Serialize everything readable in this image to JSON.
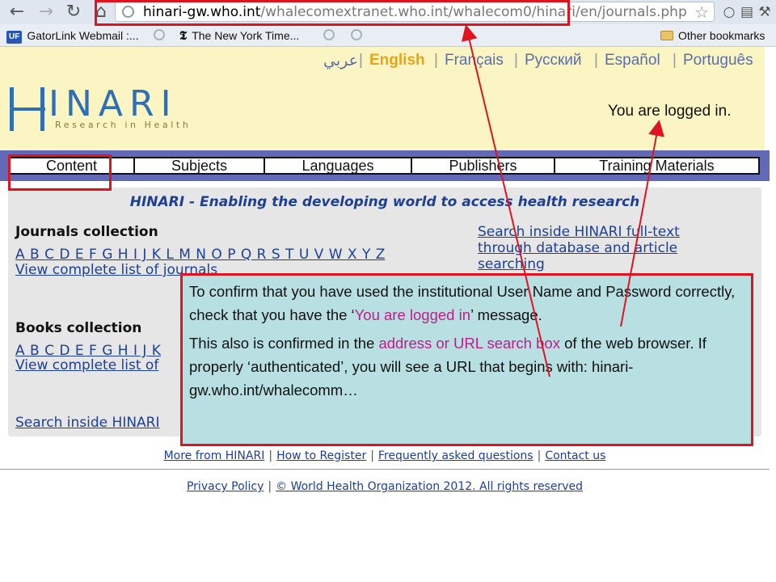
{
  "browser": {
    "url_host": "hinari-gw.who.int",
    "url_path": "/whalecomextranet.who.int/whalecom0/hinari/en/journals.php",
    "nav_icons": [
      "back-icon",
      "forward-icon",
      "reload-icon",
      "home-icon"
    ],
    "toolbar_icons": [
      "star-icon",
      "skype-icon",
      "page-icon",
      "wrench-icon"
    ],
    "bookmarks": [
      {
        "badge": "UF",
        "label": "GatorLink Webmail :..."
      },
      {
        "badge": "𝕿",
        "label": "The New York Time..."
      }
    ],
    "other_bookmarks": "Other bookmarks"
  },
  "header": {
    "languages": [
      "عربي",
      "English",
      "Français",
      "Русский",
      "Español",
      "Português"
    ],
    "active_language": "English",
    "logo_text": "INARI",
    "logo_tagline": "Research in Health",
    "status_text": "You are logged in."
  },
  "menu": [
    "Content",
    "Subjects",
    "Languages",
    "Publishers",
    "Training Materials"
  ],
  "main": {
    "tagline": "HINARI - Enabling the developing world to access health research",
    "journals_title": "Journals collection",
    "journals_alpha": "A B C D E F G H I J K L M N O P Q R S T U V W X Y Z",
    "journals_view_all": "View complete list of journals",
    "search_fulltext": "Search inside HINARI full-text through database and article searching",
    "books_title": "Books collection",
    "books_alpha": "A B C D E F G H I J K",
    "books_view_all": "View complete list of",
    "search_bottom": "Search inside HINARI"
  },
  "footer": {
    "row1": [
      "More from HINARI",
      "How to Register",
      "Frequently asked questions",
      "Contact us"
    ],
    "row2": [
      "Privacy Policy",
      "© World Health Organization 2012. All rights reserved"
    ]
  },
  "callout": {
    "p1_before": "To confirm that you have used the institutional User Name and Password correctly, check that you have the ‘",
    "p1_highlight": "You are logged in",
    "p1_after": "’ message.",
    "p2_before": "This also is confirmed in the ",
    "p2_highlight": "address or URL search box",
    "p2_after": " of the web browser.  If properly ‘authenticated’, you will see a URL that begins with: hinari-gw.who.int/whalecomm…"
  },
  "colors": {
    "annotation_red": "#e0141e",
    "callout_bg": "#b8dfe2",
    "highlight": "#c51a8a",
    "menu_bar": "#6269b6",
    "header_bg": "#fbf5c4"
  }
}
